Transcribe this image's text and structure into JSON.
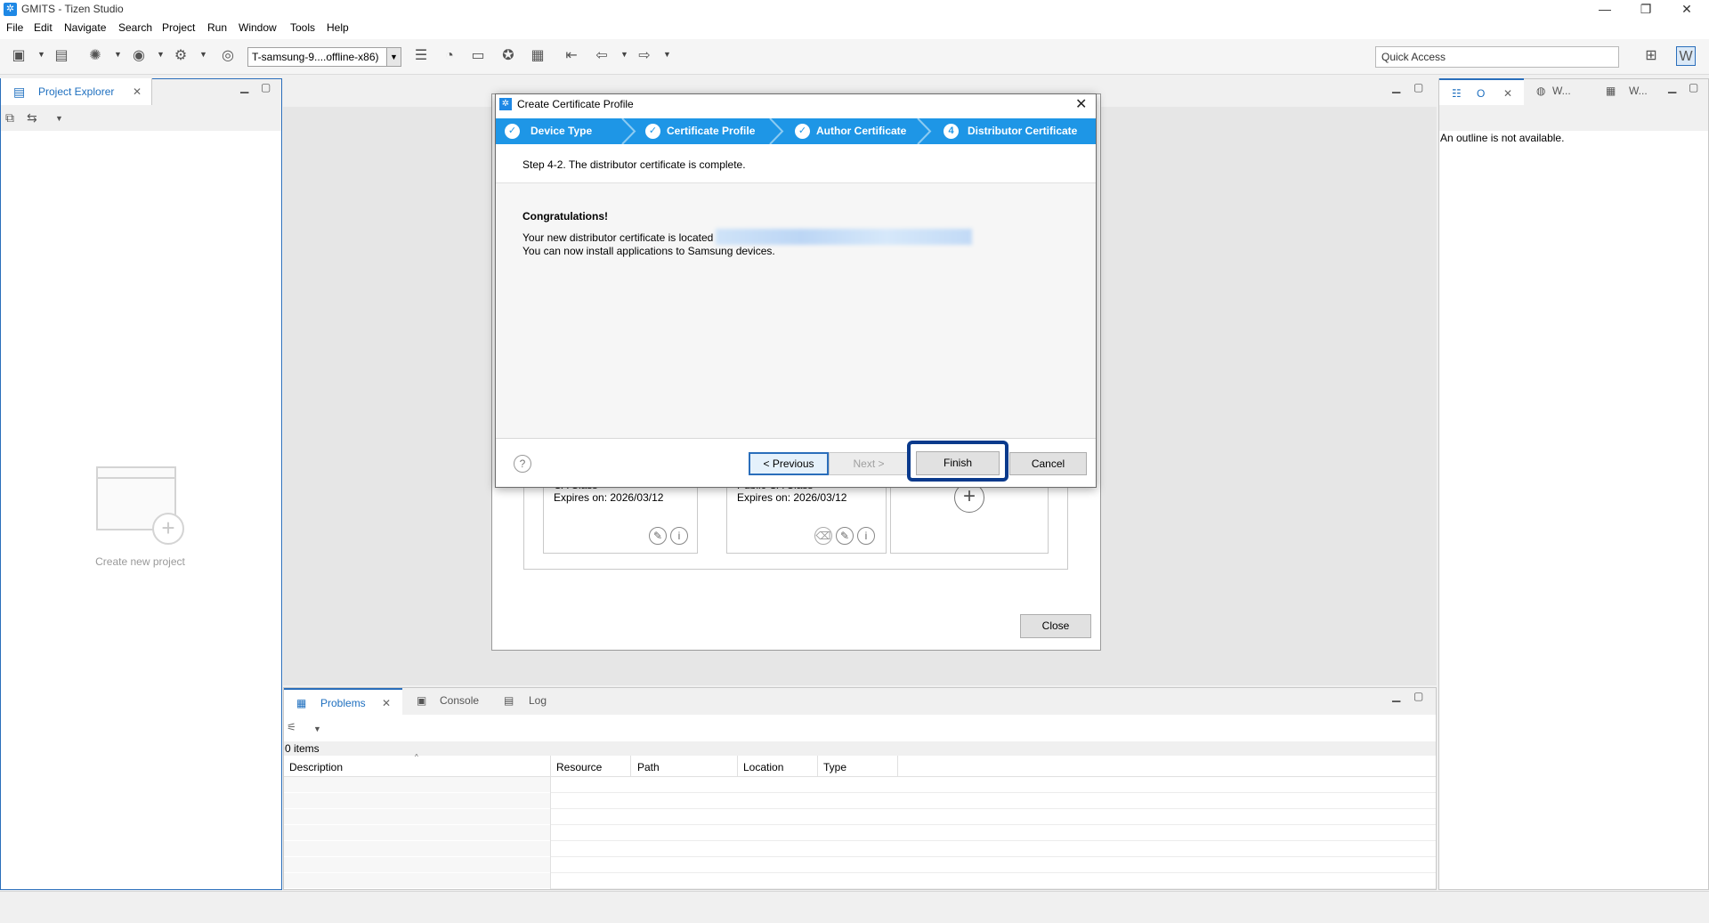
{
  "app": {
    "title": "GMITS - Tizen Studio",
    "icon": "tizen-icon"
  },
  "window_controls": {
    "minimize": "—",
    "restore": "❐",
    "close": "✕"
  },
  "menu": [
    "File",
    "Edit",
    "Navigate",
    "Search",
    "Project",
    "Run",
    "Window",
    "Tools",
    "Help"
  ],
  "toolbar": {
    "target": "T-samsung-9....offline-x86)",
    "quick_access": "Quick Access"
  },
  "project_explorer": {
    "tab": "Project Explorer",
    "create_project": "Create new project"
  },
  "outline": {
    "tab": "O",
    "tab2": "W...",
    "tab3": "W...",
    "message": "An outline is not available."
  },
  "background_dialog": {
    "card1_title": "CA Class",
    "card1_expiry": "Expires on: 2026/03/12",
    "card2_title": "Public CA Class",
    "card2_expiry": "Expires on: 2026/03/12",
    "close_label": "Close"
  },
  "dialog": {
    "title": "Create Certificate Profile",
    "steps": [
      {
        "label": "Device Type",
        "state": "done"
      },
      {
        "label": "Certificate Profile",
        "state": "done"
      },
      {
        "label": "Author Certificate",
        "state": "done"
      },
      {
        "label": "Distributor Certificate",
        "state": "current",
        "number": "4"
      }
    ],
    "step_description": "Step 4-2. The distributor certificate is complete.",
    "congrats": "Congratulations!",
    "line1": "Your new distributor certificate is located",
    "line2": "You can now install applications to Samsung devices.",
    "buttons": {
      "previous": "< Previous",
      "next": "Next >",
      "finish": "Finish",
      "cancel": "Cancel"
    },
    "help": "?"
  },
  "bottom_panel": {
    "tabs": [
      "Problems",
      "Console",
      "Log"
    ],
    "item_count": "0 items",
    "columns": [
      "Description",
      "Resource",
      "Path",
      "Location",
      "Type"
    ]
  },
  "colors": {
    "accent": "#1e96e6",
    "highlight": "#0a3a8c"
  }
}
